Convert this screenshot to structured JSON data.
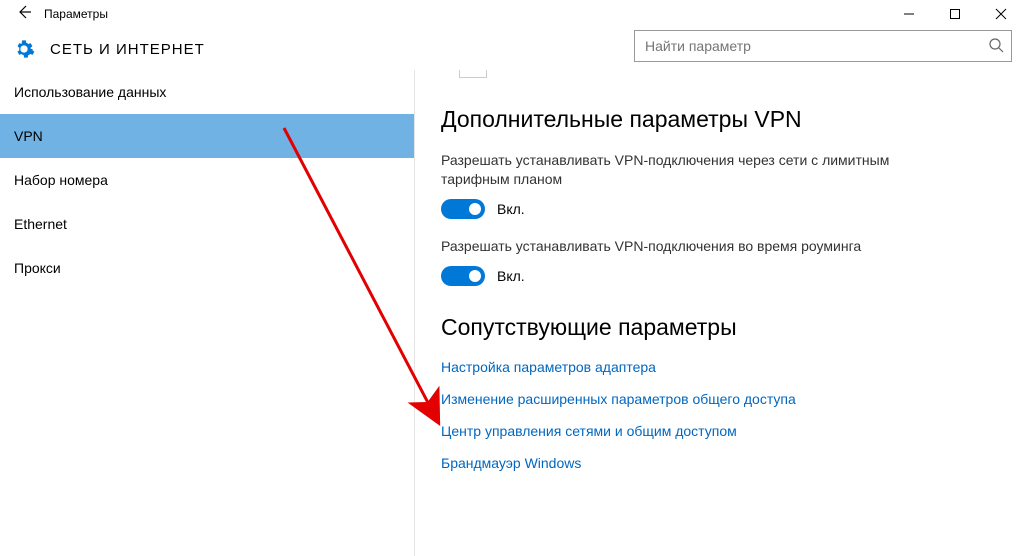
{
  "window": {
    "title": "Параметры"
  },
  "header": {
    "title": "СЕТЬ И ИНТЕРНЕТ"
  },
  "search": {
    "placeholder": "Найти параметр"
  },
  "sidebar": {
    "items": [
      {
        "label": "Использование данных"
      },
      {
        "label": "VPN"
      },
      {
        "label": "Набор номера"
      },
      {
        "label": "Ethernet"
      },
      {
        "label": "Прокси"
      }
    ],
    "selected_index": 1
  },
  "main": {
    "advanced_title": "Дополнительные параметры VPN",
    "setting1_label": "Разрешать устанавливать VPN-подключения через сети с лимитным тарифным планом",
    "setting1_state": "Вкл.",
    "setting2_label": "Разрешать устанавливать VPN-подключения во время роуминга",
    "setting2_state": "Вкл.",
    "related_title": "Сопутствующие параметры",
    "links": [
      "Настройка параметров адаптера",
      "Изменение расширенных параметров общего доступа",
      "Центр управления сетями и общим доступом",
      "Брандмауэр Windows"
    ]
  }
}
